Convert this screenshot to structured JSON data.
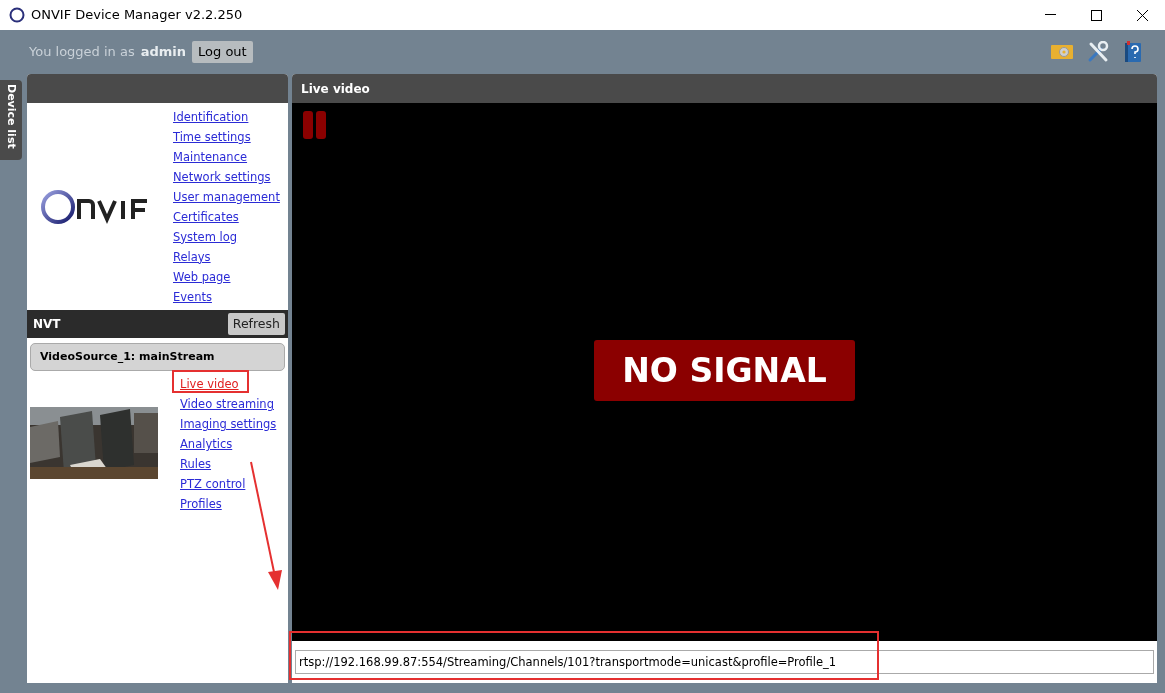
{
  "window": {
    "title": "ONVIF Device Manager v2.2.250"
  },
  "header": {
    "login_text": "You logged in as",
    "user": "admin",
    "logout_button": "Log out"
  },
  "side_tab": {
    "label": "Device list"
  },
  "device_menu": {
    "links": [
      "Identification",
      "Time settings",
      "Maintenance",
      "Network settings",
      "User management",
      "Certificates",
      "System log",
      "Relays",
      "Web page",
      "Events"
    ]
  },
  "nvt": {
    "title": "NVT",
    "refresh_button": "Refresh",
    "source": "VideoSource_1: mainStream",
    "links": [
      {
        "label": "Live video",
        "selected": true
      },
      {
        "label": "Video streaming",
        "selected": false
      },
      {
        "label": "Imaging settings",
        "selected": false
      },
      {
        "label": "Analytics",
        "selected": false
      },
      {
        "label": "Rules",
        "selected": false
      },
      {
        "label": "PTZ control",
        "selected": false
      },
      {
        "label": "Profiles",
        "selected": false
      }
    ]
  },
  "live_video": {
    "title": "Live video",
    "status": "NO SIGNAL",
    "stream_url": "rtsp://192.168.99.87:554/Streaming/Channels/101?transportmode=unicast&profile=Profile_1"
  }
}
